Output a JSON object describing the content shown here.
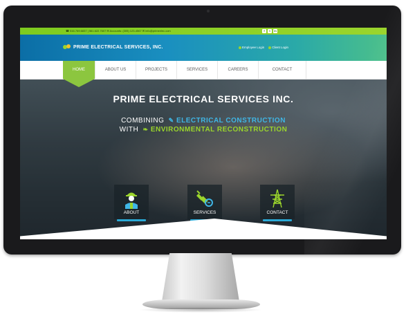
{
  "topbar": {
    "contacts": "☎ 516.769.6837 | 561.622.7607   ✉ Accounts: (305) 123-4567   ✉ info@primeelec.com",
    "social_icons": [
      "facebook-icon",
      "twitter-icon",
      "linkedin-icon"
    ]
  },
  "header": {
    "logo_text": "PRIME ELECTRICAL SERVICES, INC.",
    "employee_login": "Employee Login",
    "client_login": "Client Login"
  },
  "nav": {
    "items": [
      "HOME",
      "ABOUT US",
      "PROJECTS",
      "SERVICES",
      "CAREERS",
      "CONTACT"
    ],
    "active": "HOME"
  },
  "hero": {
    "title": "PRIME ELECTRICAL SERVICES INC.",
    "line1_prefix": "COMBINING",
    "line1_highlight": "ELECTRICAL CONSTRUCTION",
    "line2_prefix": "WITH",
    "line2_highlight": "ENVIRONMENTAL RECONSTRUCTION",
    "tiles": [
      "ABOUT",
      "SERVICES",
      "CONTACT"
    ]
  },
  "colors": {
    "accent_green": "#8cc63f",
    "accent_blue": "#3fb6e6",
    "header_start": "#0b6ea6",
    "header_end": "#4cc08a"
  }
}
